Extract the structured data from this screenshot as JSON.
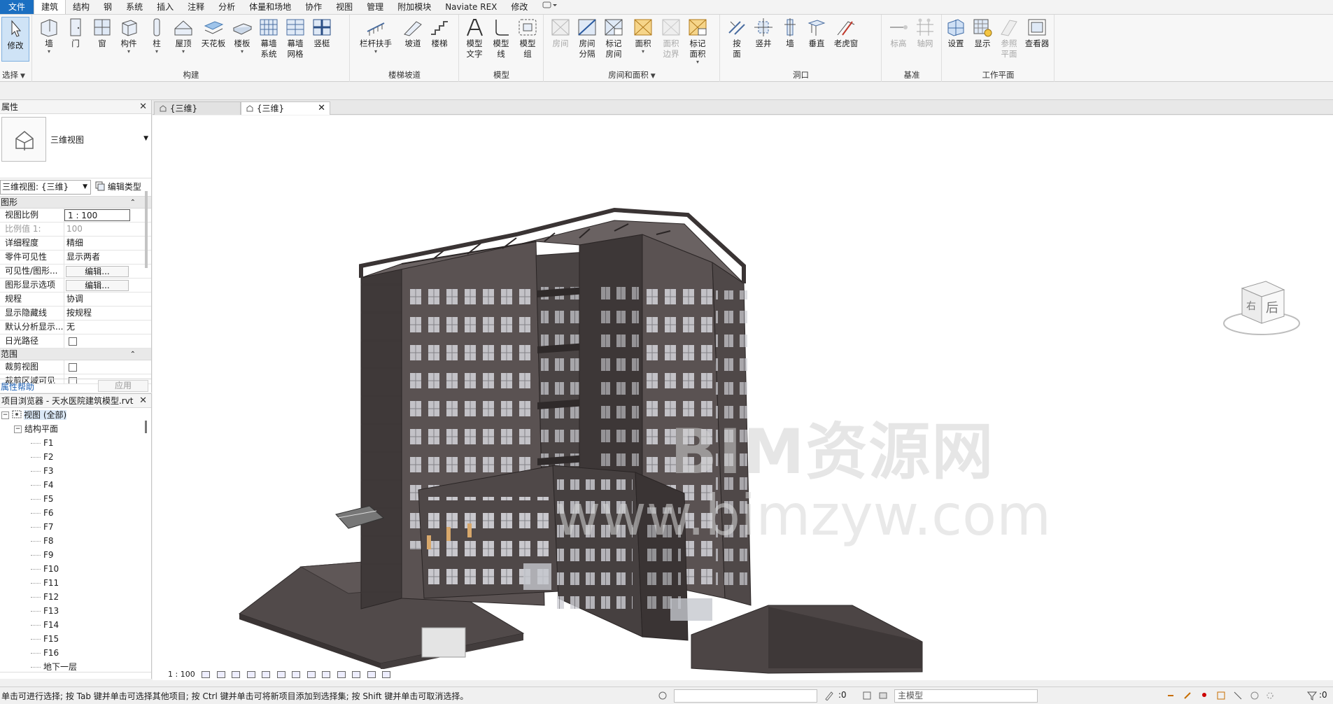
{
  "ribbon": {
    "tabs": [
      "文件",
      "建筑",
      "结构",
      "钢",
      "系统",
      "插入",
      "注释",
      "分析",
      "体量和场地",
      "协作",
      "视图",
      "管理",
      "附加模块",
      "Naviate REX",
      "修改"
    ],
    "active_tab": "建筑",
    "select_tool": "修改",
    "select_label": "选择",
    "groups": {
      "build": {
        "title": "构建",
        "buttons": [
          "墙",
          "门",
          "窗",
          "构件",
          "柱",
          "屋顶",
          "天花板",
          "楼板",
          "幕墙\n系统",
          "幕墙\n网格",
          "竖梃"
        ]
      },
      "stairs": {
        "title": "楼梯坡道",
        "buttons": [
          "栏杆扶手",
          "坡道",
          "楼梯"
        ]
      },
      "model": {
        "title": "模型",
        "buttons": [
          "模型\n文字",
          "模型\n线",
          "模型\n组"
        ]
      },
      "rooms": {
        "title": "房间和面积",
        "buttons": [
          "房间",
          "房间\n分隔",
          "标记\n房间",
          "面积",
          "面积\n边界",
          "标记\n面积"
        ]
      },
      "opening": {
        "title": "洞口",
        "buttons": [
          "按\n面",
          "竖井",
          "墙",
          "垂直",
          "老虎窗"
        ]
      },
      "datum": {
        "title": "基准",
        "buttons": [
          "标高",
          "轴网"
        ]
      },
      "workplane": {
        "title": "工作平面",
        "buttons": [
          "设置",
          "显示",
          "参照\n平面",
          "查看器"
        ]
      }
    }
  },
  "properties": {
    "title": "属性",
    "type_name": "三维视图",
    "instance_selector": "三维视图: {三维}",
    "edit_type": "编辑类型",
    "groups": [
      {
        "name": "图形",
        "rows": [
          {
            "key": "视图比例",
            "value": "1 : 100",
            "kind": "input"
          },
          {
            "key": "比例值 1:",
            "value": "100",
            "kind": "disabled"
          },
          {
            "key": "详细程度",
            "value": "精细",
            "kind": "text"
          },
          {
            "key": "零件可见性",
            "value": "显示两者",
            "kind": "text"
          },
          {
            "key": "可见性/图形...",
            "value": "编辑...",
            "kind": "button"
          },
          {
            "key": "图形显示选项",
            "value": "编辑...",
            "kind": "button"
          },
          {
            "key": "规程",
            "value": "协调",
            "kind": "text"
          },
          {
            "key": "显示隐藏线",
            "value": "按规程",
            "kind": "text"
          },
          {
            "key": "默认分析显示...",
            "value": "无",
            "kind": "text"
          },
          {
            "key": "日光路径",
            "value": "",
            "kind": "checkbox"
          }
        ]
      },
      {
        "name": "范围",
        "rows": [
          {
            "key": "裁剪视图",
            "value": "",
            "kind": "checkbox"
          },
          {
            "key": "裁剪区域可见",
            "value": "",
            "kind": "checkbox"
          }
        ]
      }
    ],
    "help_link": "属性帮助",
    "apply": "应用"
  },
  "browser": {
    "title": "项目浏览器 - 天水医院建筑模型.rvt",
    "root": "视图 (全部)",
    "group": "结构平面",
    "levels": [
      "F1",
      "F2",
      "F3",
      "F4",
      "F5",
      "F6",
      "F7",
      "F8",
      "F9",
      "F10",
      "F11",
      "F12",
      "F13",
      "F14",
      "F15",
      "F16",
      "地下一层"
    ]
  },
  "doc_tabs": [
    {
      "label": "{三维}",
      "active": false
    },
    {
      "label": "{三维}",
      "active": true
    }
  ],
  "viewport": {
    "watermark_line1": "BIM资源网",
    "watermark_line2": "www.bimzyw.com",
    "viewcube_face": "后",
    "viewcube_side": "右"
  },
  "view_bar": {
    "scale": "1 : 100"
  },
  "status": {
    "text": "单击可进行选择; 按 Tab 键并单击可选择其他项目; 按 Ctrl 键并单击可将新项目添加到选择集; 按 Shift 键并单击可取消选择。",
    "count1": ":0",
    "model": "主模型",
    "count2": ":0"
  },
  "colors": {
    "file_tab": "#1b6fc1",
    "building": "#5a5252",
    "building_dark": "#3f3939",
    "window": "#d9d9de",
    "window_warm": "#d8a86b"
  }
}
